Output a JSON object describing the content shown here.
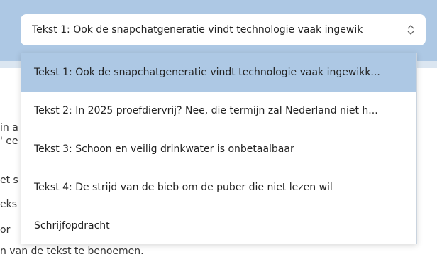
{
  "select": {
    "value": "Tekst 1: Ook de snapchatgeneratie vindt technologie vaak ingewik"
  },
  "dropdown": {
    "options": [
      {
        "label": "Tekst 1: Ook de snapchatgeneratie vindt technologie vaak ingewikk...",
        "selected": true
      },
      {
        "label": "Tekst 2: In 2025 proefdiervrij? Nee, die termijn zal Nederland niet h...",
        "selected": false
      },
      {
        "label": "Tekst 3: Schoon en veilig drinkwater is onbetaalbaar",
        "selected": false
      },
      {
        "label": "Tekst 4: De strijd van de bieb om de puber die niet lezen wil",
        "selected": false
      },
      {
        "label": "Schrijfopdracht",
        "selected": false
      }
    ]
  },
  "background": {
    "line1": "in a",
    "line2": "' ee",
    "line3": "et s",
    "line4": "eks",
    "line5": "or",
    "line6": "n van de tekst te benoemen."
  },
  "colors": {
    "accent": "#adc8e4",
    "band": "#dbe6f1"
  }
}
